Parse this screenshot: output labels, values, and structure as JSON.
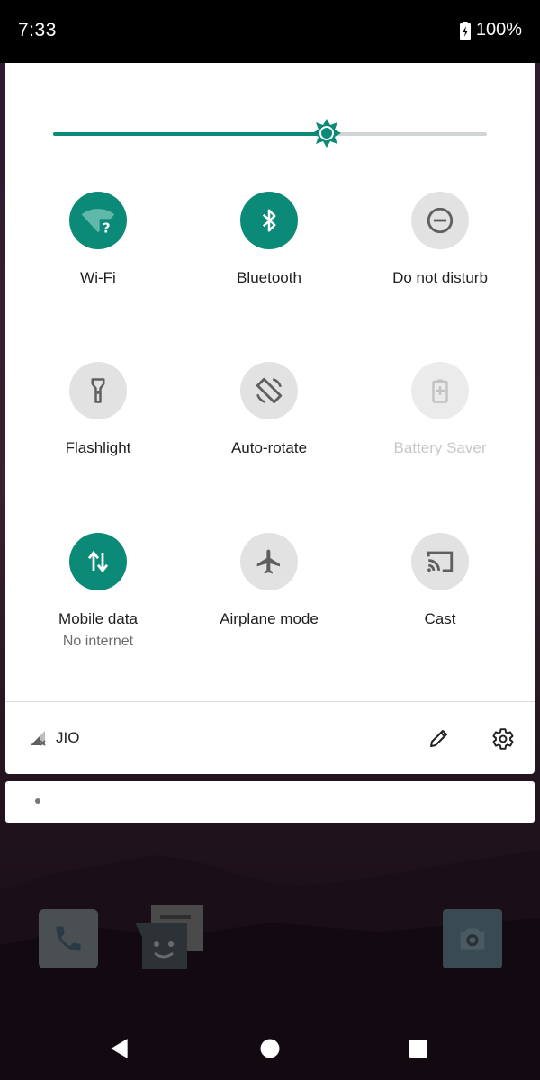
{
  "status_bar": {
    "time": "7:33",
    "battery_percent": "100%",
    "battery_icon": "battery-charging-icon"
  },
  "brightness": {
    "level": 0.63,
    "accent_color": "#0b8a78",
    "track_color": "#cfd6d5"
  },
  "tiles": [
    {
      "label": "Wi-Fi",
      "sublabel": "",
      "icon": "wifi-question-icon",
      "state": "on"
    },
    {
      "label": "Bluetooth",
      "sublabel": "",
      "icon": "bluetooth-icon",
      "state": "on"
    },
    {
      "label": "Do not disturb",
      "sublabel": "",
      "icon": "do-not-disturb-icon",
      "state": "off"
    },
    {
      "label": "Flashlight",
      "sublabel": "",
      "icon": "flashlight-icon",
      "state": "off"
    },
    {
      "label": "Auto-rotate",
      "sublabel": "",
      "icon": "auto-rotate-icon",
      "state": "off"
    },
    {
      "label": "Battery Saver",
      "sublabel": "",
      "icon": "battery-saver-icon",
      "state": "unavailable"
    },
    {
      "label": "Mobile data",
      "sublabel": "No internet",
      "icon": "mobile-data-icon",
      "state": "on"
    },
    {
      "label": "Airplane mode",
      "sublabel": "",
      "icon": "airplane-icon",
      "state": "off"
    },
    {
      "label": "Cast",
      "sublabel": "",
      "icon": "cast-icon",
      "state": "off"
    }
  ],
  "footer": {
    "carrier": "JIO",
    "signal_icon": "signal-no-service-icon",
    "edit_icon": "pencil-icon",
    "settings_icon": "gear-icon"
  },
  "home_screen": {
    "dock_icons": [
      "phone-icon",
      "messages-icon",
      "camera-icon"
    ]
  },
  "nav_bar": {
    "icons": [
      "back-icon",
      "home-icon",
      "recents-icon"
    ]
  }
}
